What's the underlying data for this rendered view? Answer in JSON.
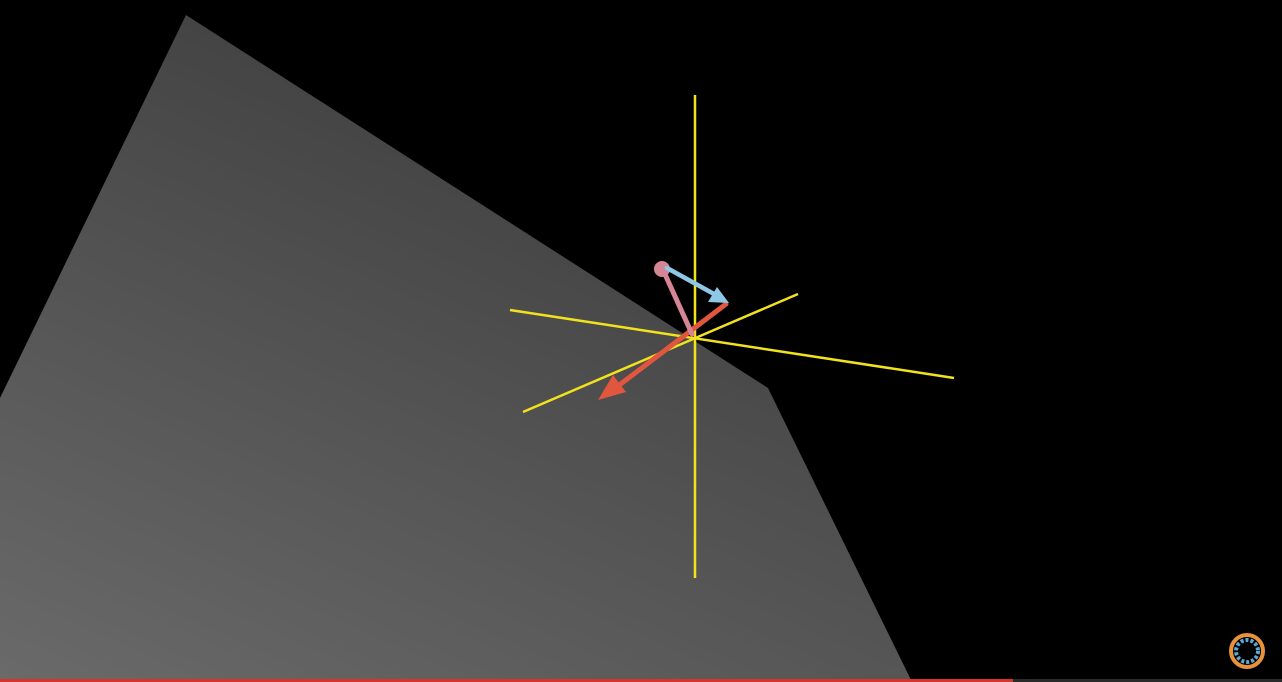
{
  "scene": {
    "background_color": "#000000",
    "plane_color_light": "#6a6a6a",
    "plane_color_dark": "#3c3c3c",
    "axis_color": "#f2e21e",
    "vectors": [
      {
        "name": "red-vector",
        "color": "#e0563e"
      },
      {
        "name": "pink-vector",
        "color": "#d58594"
      },
      {
        "name": "blue-vector",
        "color": "#8fc8e6"
      }
    ]
  },
  "progress": {
    "fraction": 0.79,
    "fill_color": "#d9342a"
  },
  "loading_indicator": {
    "icon": "loading-spinner-icon",
    "color_outer": "#e9923a",
    "color_inner": "#5aa9d6"
  }
}
